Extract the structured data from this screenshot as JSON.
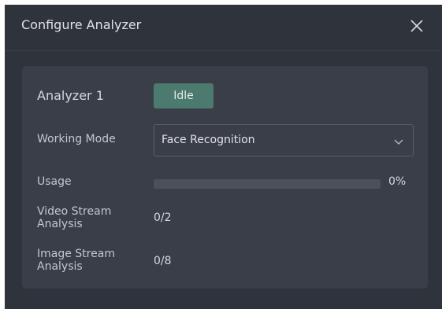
{
  "dialog": {
    "title": "Configure Analyzer",
    "close_icon": "close-icon"
  },
  "analyzer": {
    "name": "Analyzer 1",
    "status": "Idle",
    "status_color": "#4d7a6f"
  },
  "working_mode": {
    "label": "Working Mode",
    "value": "Face Recognition",
    "icon": "chevron-down-icon"
  },
  "usage": {
    "label": "Usage",
    "percent_text": "0%",
    "level": 0
  },
  "video_stream": {
    "label_line1": "Video Stream",
    "label_line2": "Analysis",
    "value": "0/2"
  },
  "image_stream": {
    "label_line1": "Image Stream",
    "label_line2": "Analysis",
    "value": "0/8"
  }
}
